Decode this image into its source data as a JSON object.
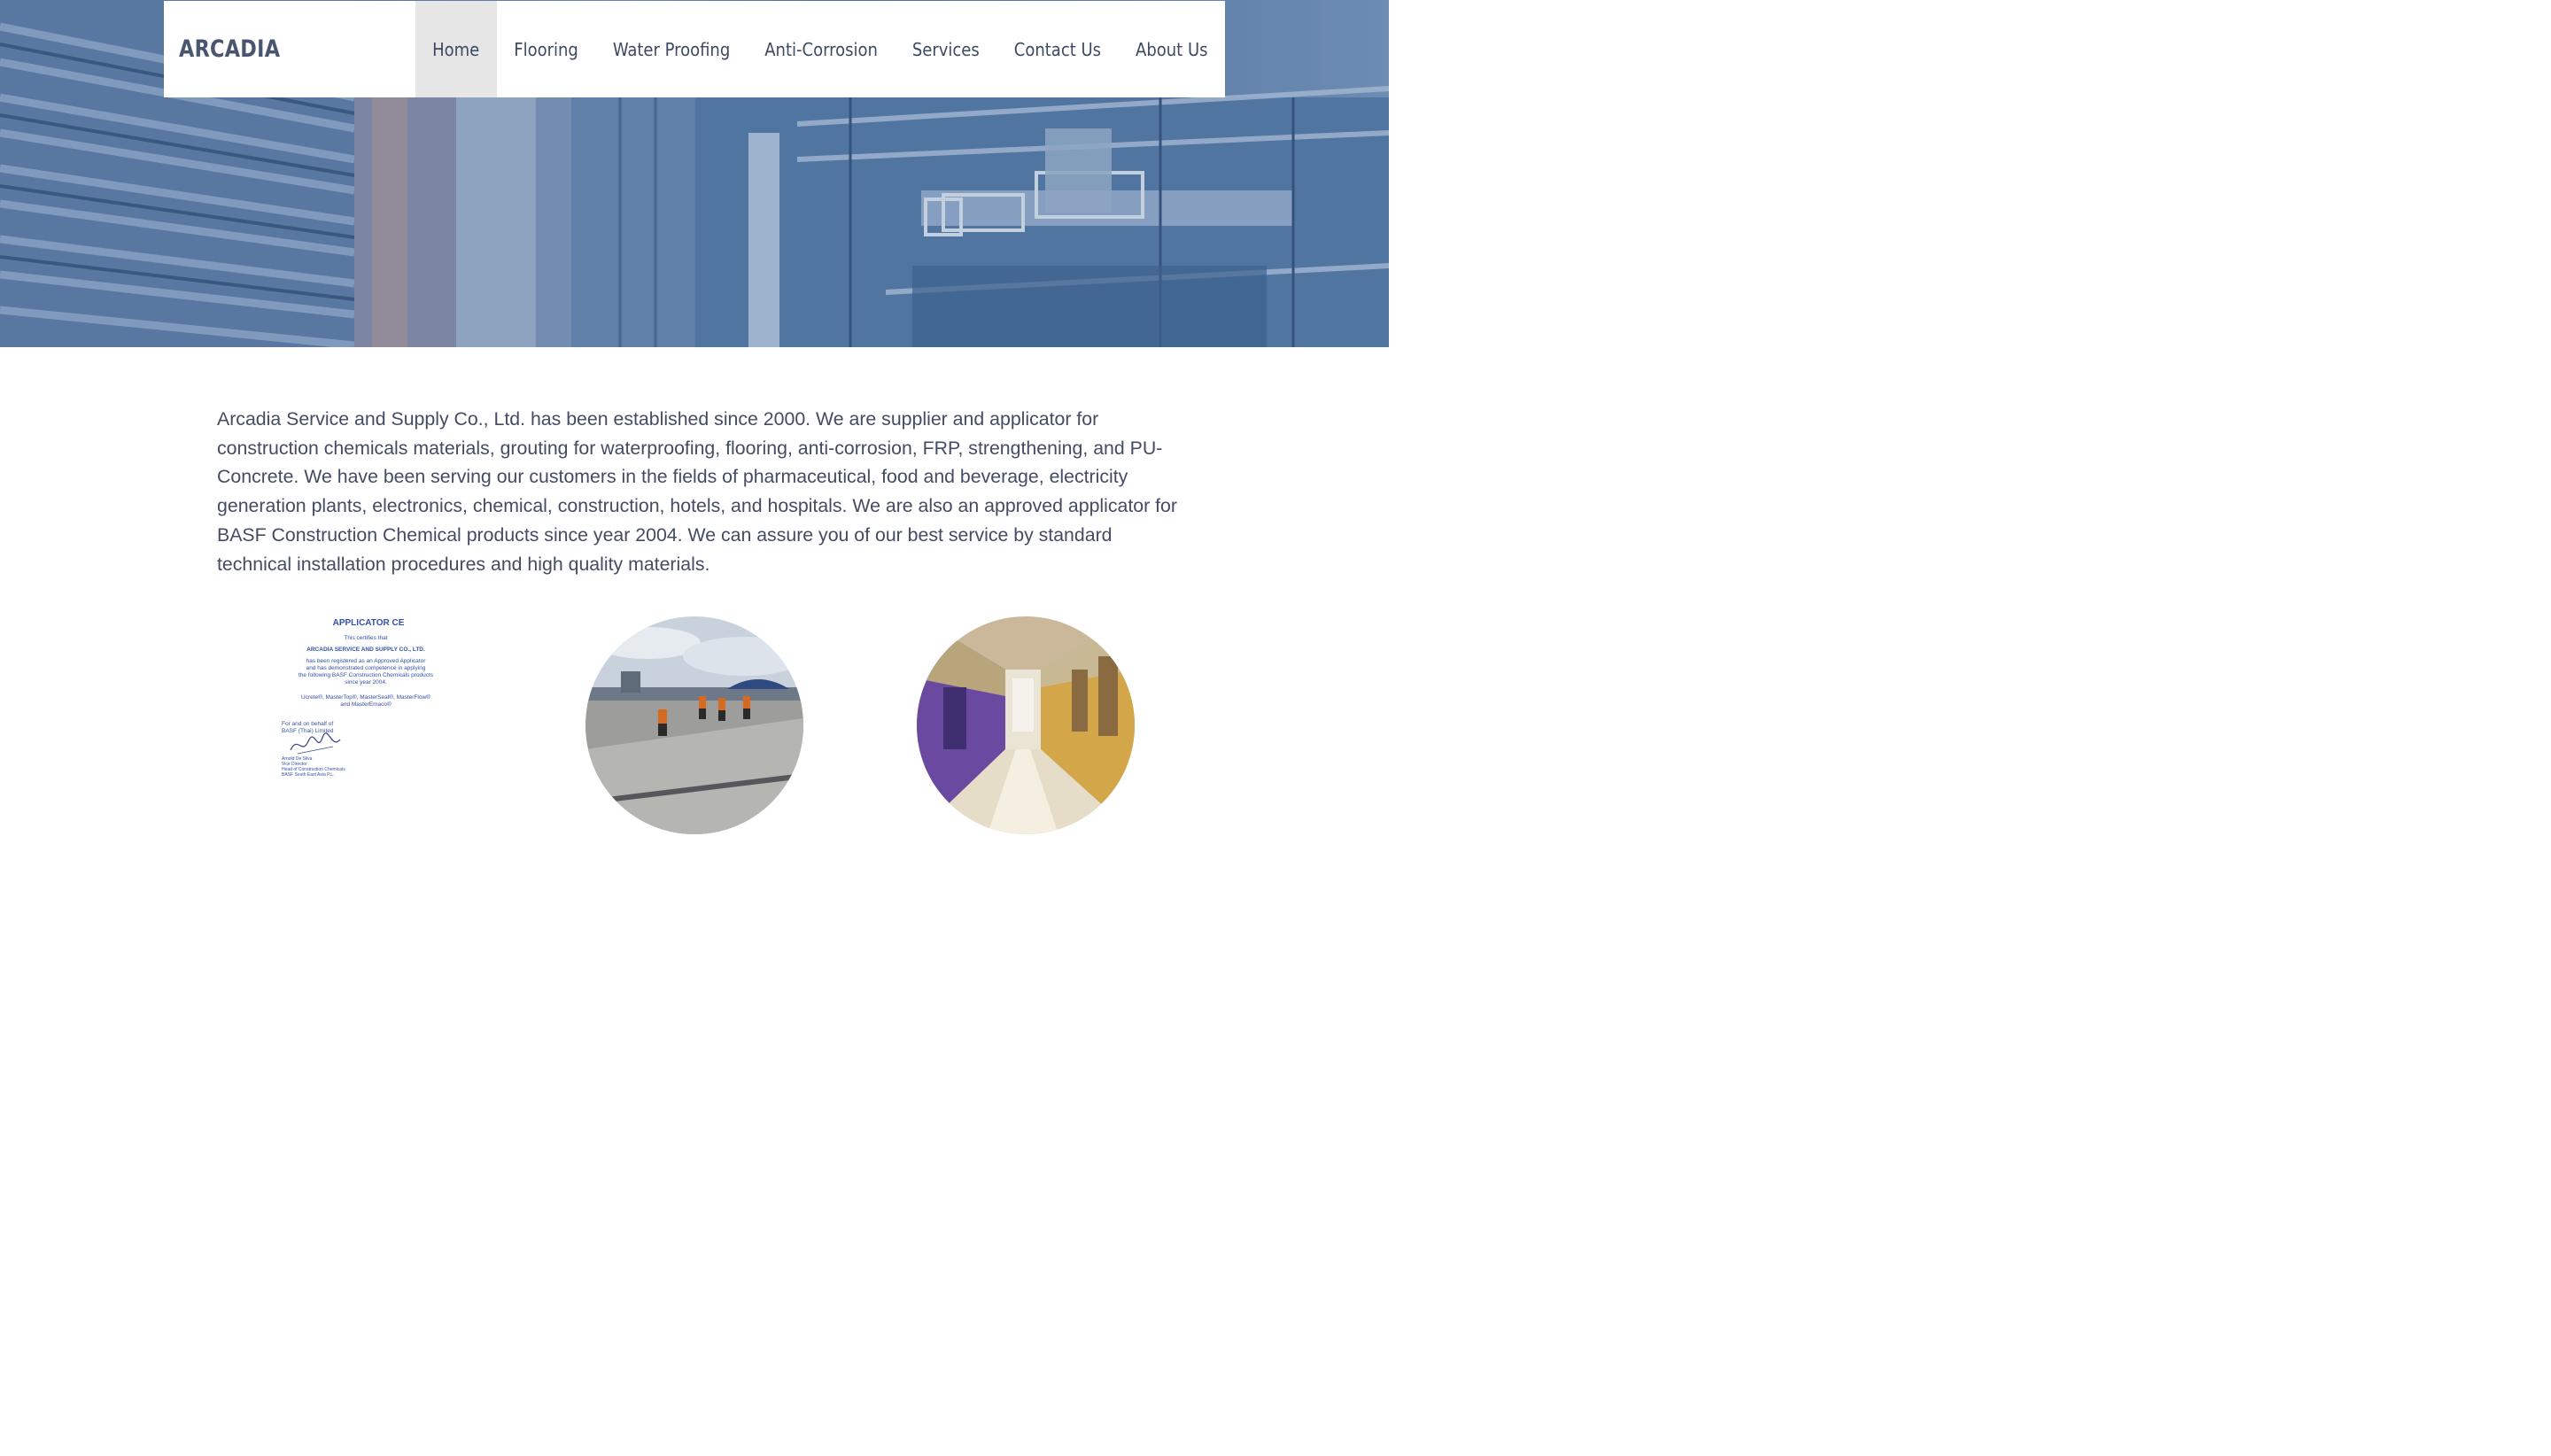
{
  "brand": "ARCADIA",
  "nav": {
    "items": [
      "Home",
      "Flooring",
      "Water Proofing",
      "Anti-Corrosion",
      "Services",
      "Contact Us",
      "About Us"
    ],
    "active": "Home"
  },
  "intro": {
    "text": "Arcadia Service and Supply Co., Ltd. has been established since 2000. We are supplier and applicator for construction chemicals materials, grouting for waterproofing, flooring, anti-corrosion, FRP, strengthening, and PU-Concrete. We have been serving our customers in the fields of pharmaceutical, food and beverage, electricity generation plants, electronics, chemical, construction, hotels, and hospitals. We are also an approved applicator for BASF Construction Chemical products since year 2004. We can assure you of our best service by standard technical installation procedures and high quality materials."
  },
  "certificate": {
    "heading": "APPLICATOR CE",
    "lines": [
      "This certifies that",
      "ARCADIA SERVICE AND SUPPLY CO., LTD.",
      "has been registered as an Approved Applicator",
      "and has demonstrated competence in applying",
      "the following BASF Construction Chemicals products",
      "since year 2004.",
      "Ucrete®, MasterTop®, MasterSeal®, MasterFlow®",
      "and MasterEmaco®"
    ],
    "signoff": [
      "For and on behalf of",
      "BASF (Thai) Limited"
    ],
    "signatory": [
      "Arnold De Silva",
      "Vice Director",
      "Head of Construction Chemicals",
      "BASF South East Asia P.L."
    ]
  },
  "colors": {
    "nav_text": "#3e4a61",
    "nav_active_bg": "#e6e6e6",
    "body_text": "#434c63",
    "hero_tint": "#5a7aa3"
  }
}
